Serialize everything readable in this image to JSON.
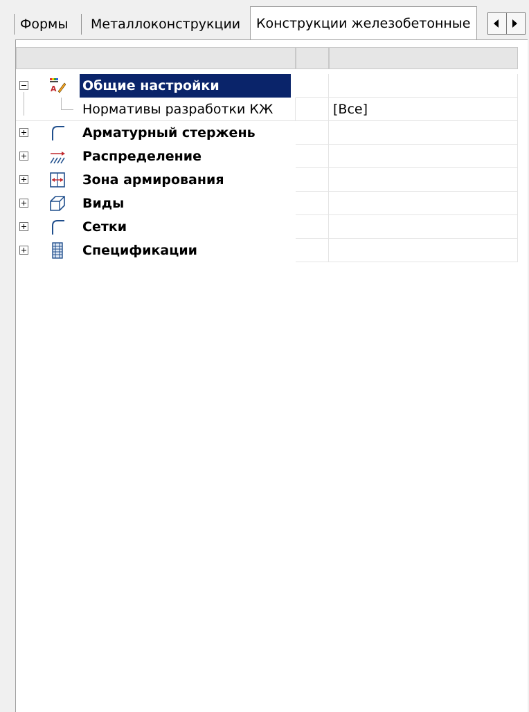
{
  "tabs": [
    {
      "label": "Формы"
    },
    {
      "label": "Металлоконструкции"
    },
    {
      "label": "Конструкции железобетонные",
      "active": true
    }
  ],
  "tree": {
    "rows": [
      {
        "label": "Общие настройки",
        "bold": true,
        "selected": true,
        "expander": "minus",
        "icon": "general-settings-icon",
        "value": ""
      },
      {
        "label": "Нормативы разработки КЖ",
        "bold": false,
        "selected": false,
        "expander": "none",
        "icon": "",
        "value": "[Все]"
      },
      {
        "label": "Арматурный стержень",
        "bold": true,
        "selected": false,
        "expander": "plus",
        "icon": "rebar-icon",
        "value": ""
      },
      {
        "label": "Распределение",
        "bold": true,
        "selected": false,
        "expander": "plus",
        "icon": "distribution-icon",
        "value": ""
      },
      {
        "label": "Зона армирования",
        "bold": true,
        "selected": false,
        "expander": "plus",
        "icon": "reinforcement-zone-icon",
        "value": ""
      },
      {
        "label": "Виды",
        "bold": true,
        "selected": false,
        "expander": "plus",
        "icon": "views-icon",
        "value": ""
      },
      {
        "label": "Сетки",
        "bold": true,
        "selected": false,
        "expander": "plus",
        "icon": "mesh-icon",
        "value": ""
      },
      {
        "label": "Спецификации",
        "bold": true,
        "selected": false,
        "expander": "plus",
        "icon": "specifications-icon",
        "value": ""
      }
    ]
  },
  "colors": {
    "selection": "#0a246a",
    "icon_blue": "#1f4e8c",
    "icon_red": "#c0282d"
  }
}
